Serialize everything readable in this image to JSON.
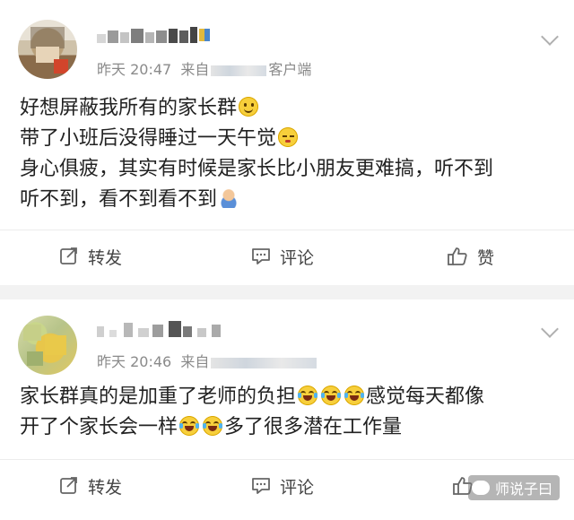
{
  "posts": [
    {
      "time": "昨天 20:47",
      "source_prefix": "来自",
      "source_suffix": "客户端",
      "lines": [
        "好想屏蔽我所有的家长群",
        "带了小班后没得睡过一天午觉",
        "身心俱疲，其实有时候是家长比小朋友更难搞，听不到",
        "听不到，看不到看不到"
      ],
      "actions": {
        "repost": "转发",
        "comment": "评论",
        "like": "赞"
      }
    },
    {
      "time": "昨天 20:46",
      "source_prefix": "来自",
      "source_suffix": "",
      "lines": [
        "家长群真的是加重了老师的负担",
        "感觉每天都像",
        "开了个家长会一样",
        "多了很多潜在工作量"
      ],
      "actions": {
        "repost": "转发",
        "comment": "评论"
      }
    }
  ],
  "watermark": "师说子曰",
  "icons": {
    "repost": "repost-icon",
    "comment": "comment-icon",
    "like": "thumbs-up-icon",
    "menu": "chevron-down-icon"
  },
  "colors": {
    "background": "#f2f2f2",
    "card": "#ffffff",
    "meta_text": "#8a8a8a",
    "body_text": "#222222"
  }
}
